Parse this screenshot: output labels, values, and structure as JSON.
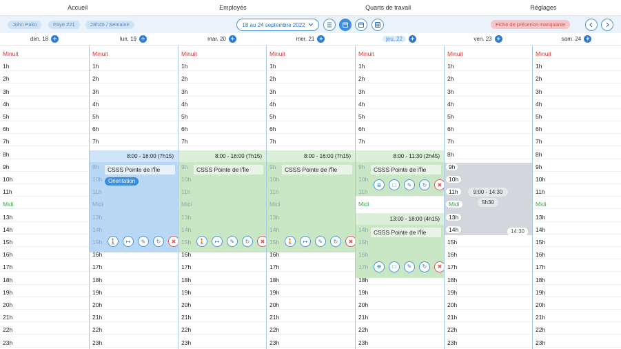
{
  "nav": [
    "Accueil",
    "Employés",
    "Quarts de travail",
    "Réglages"
  ],
  "toolbar": {
    "employee": "John Pako",
    "pay": "Paye #21",
    "weekly_hours": "28h45 / Semaine",
    "date_range": "18 au 24 septembre 2022",
    "missing_sheet": "Fiche de présence manquante"
  },
  "days": [
    {
      "label": "dim. 18",
      "today": false
    },
    {
      "label": "lun. 19",
      "today": false
    },
    {
      "label": "mar. 20",
      "today": false
    },
    {
      "label": "mer. 21",
      "today": false
    },
    {
      "label": "jeu. 22",
      "today": true
    },
    {
      "label": "ven. 23",
      "today": false
    },
    {
      "label": "sam. 24",
      "today": false
    }
  ],
  "hours": [
    "Minuit",
    "1h",
    "2h",
    "3h",
    "4h",
    "5h",
    "6h",
    "7h",
    "8h",
    "9h",
    "10h",
    "11h",
    "Midi",
    "13h",
    "14h",
    "15h",
    "16h",
    "17h",
    "18h",
    "19h",
    "20h",
    "21h",
    "22h",
    "23h"
  ],
  "shifts": {
    "mon": {
      "time": "8:00 - 16:00 (7h15)",
      "location": "CSSS Pointe de l'Île",
      "tag": "Orientation"
    },
    "tue": {
      "time": "8:00 - 16:00 (7h15)",
      "location": "CSSS Pointe de l'Île"
    },
    "wed": {
      "time": "8:00 - 16:00 (7h15)",
      "location": "CSSS Pointe de l'Île"
    },
    "thu1": {
      "time": "8:00 - 11:30 (2h45)",
      "location": "CSSS Pointe de l'Île"
    },
    "thu2": {
      "time": "13:00 - 18:00 (4h15)",
      "location": "CSSS Pointe de l'Île"
    }
  },
  "availability": {
    "time": "9:00 - 14:30",
    "duration": "5h30",
    "end_badge": "14:30"
  },
  "colors": {
    "accent": "#2d7dd2",
    "shift_blue": "#b8d8f6",
    "shift_green": "#c9e6c5",
    "warning": "#f7c5c5"
  },
  "icons": {
    "timesheet_buttons": [
      "walk-in-icon",
      "walk-out-icon",
      "edit-icon",
      "swap-icon",
      "delete-icon"
    ],
    "detail_buttons": [
      "attach-icon",
      "document-icon",
      "edit-icon",
      "swap-icon",
      "delete-icon"
    ]
  }
}
